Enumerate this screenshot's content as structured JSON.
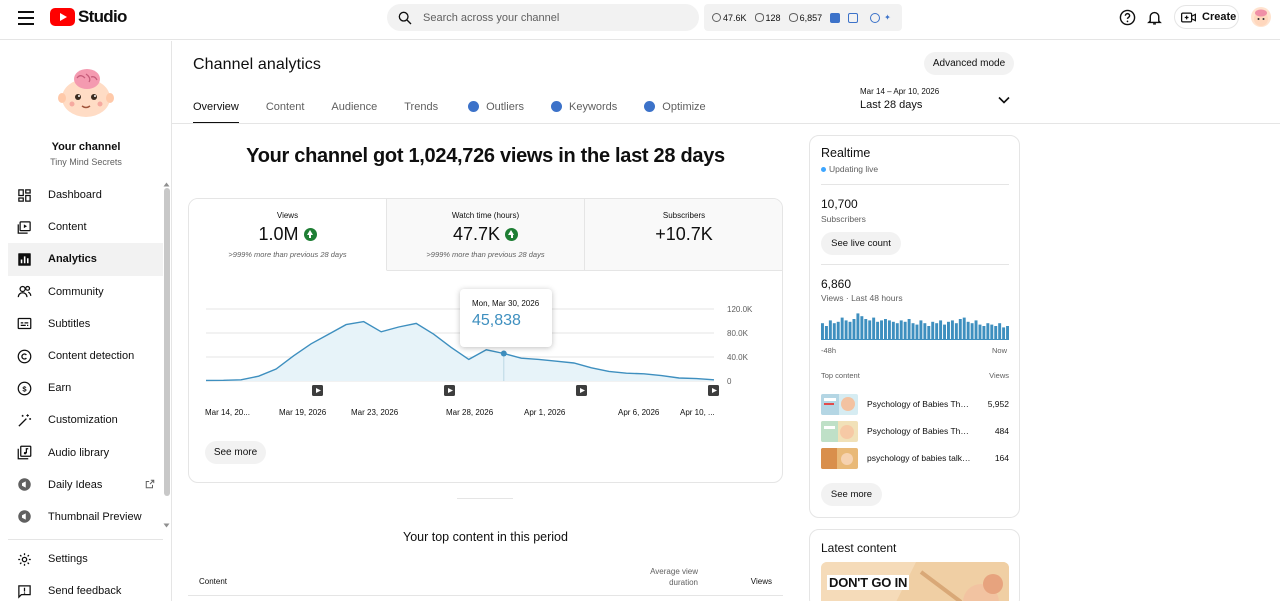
{
  "topbar": {
    "logo_text": "Studio",
    "search_placeholder": "Search across your channel",
    "stats": [
      {
        "icon": "clock-icon",
        "value": "47.6K"
      },
      {
        "icon": "eye-icon",
        "value": "128"
      },
      {
        "icon": "eye-icon",
        "value": "6,857"
      }
    ],
    "create_label": "Create"
  },
  "sidebar": {
    "channel_title": "Your channel",
    "channel_name": "Tiny Mind Secrets",
    "items": [
      {
        "label": "Dashboard",
        "icon": "dashboard-icon"
      },
      {
        "label": "Content",
        "icon": "content-icon"
      },
      {
        "label": "Analytics",
        "icon": "analytics-icon",
        "active": true
      },
      {
        "label": "Community",
        "icon": "community-icon"
      },
      {
        "label": "Subtitles",
        "icon": "subtitles-icon"
      },
      {
        "label": "Content detection",
        "icon": "copyright-icon"
      },
      {
        "label": "Earn",
        "icon": "dollar-icon"
      },
      {
        "label": "Customization",
        "icon": "magic-wand-icon"
      },
      {
        "label": "Audio library",
        "icon": "audio-library-icon"
      },
      {
        "label": "Daily Ideas",
        "icon": "extension-icon",
        "external": true
      },
      {
        "label": "Thumbnail Preview",
        "icon": "extension-icon"
      }
    ],
    "bottom_items": [
      {
        "label": "Settings",
        "icon": "gear-icon"
      },
      {
        "label": "Send feedback",
        "icon": "feedback-icon"
      }
    ]
  },
  "header": {
    "title": "Channel analytics",
    "advanced_mode": "Advanced mode",
    "tabs": [
      "Overview",
      "Content",
      "Audience",
      "Trends",
      "Outliers",
      "Keywords",
      "Optimize"
    ],
    "date_range": "Mar 14 – Apr 10, 2026",
    "date_label": "Last 28 days"
  },
  "main": {
    "headline": "Your channel got 1,024,726 views in the last 28 days",
    "metrics": [
      {
        "label": "Views",
        "value": "1.0M",
        "up": true,
        "sub": ">999% more than previous 28 days"
      },
      {
        "label": "Watch time (hours)",
        "value": "47.7K",
        "up": true,
        "sub": ">999% more than previous 28 days"
      },
      {
        "label": "Subscribers",
        "value": "+10.7K",
        "up": false,
        "sub": ""
      }
    ],
    "tooltip": {
      "date": "Mon, Mar 30, 2026",
      "value": "45,838"
    },
    "see_more": "See more",
    "top_content_title": "Your top content in this period",
    "table_headers": {
      "content": "Content",
      "avg": "Average view duration",
      "views": "Views"
    }
  },
  "chart_data": {
    "type": "area",
    "x_tick_labels": [
      "Mar 14, 20...",
      "Mar 19, 2026",
      "Mar 23, 2026",
      "Mar 28, 2026",
      "Apr 1, 2026",
      "Apr 6, 2026",
      "Apr 10, ..."
    ],
    "y_tick_labels": [
      "120.0K",
      "80.0K",
      "40.0K",
      "0"
    ],
    "ylim": [
      0,
      120000
    ],
    "values": [
      1000,
      1200,
      2000,
      8000,
      20000,
      42000,
      62000,
      78000,
      94000,
      99000,
      82000,
      90000,
      96000,
      78000,
      56000,
      36000,
      52000,
      45838,
      38000,
      36000,
      33000,
      30000,
      22000,
      16000,
      13000,
      12000,
      9000,
      5000,
      4000,
      2000
    ],
    "highlight_index": 17,
    "color": "#3e8fbf"
  },
  "realtime": {
    "title": "Realtime",
    "status": "Updating live",
    "subscribers": "10,700",
    "subscribers_label": "Subscribers",
    "see_live": "See live count",
    "views": "6,860",
    "views_label": "Views · Last 48 hours",
    "axis_left": "-48h",
    "axis_right": "Now",
    "bars": [
      12,
      10,
      14,
      12,
      13,
      16,
      14,
      13,
      15,
      19,
      17,
      15,
      14,
      16,
      13,
      14,
      15,
      14,
      13,
      12,
      14,
      13,
      15,
      12,
      11,
      14,
      12,
      10,
      13,
      12,
      14,
      11,
      13,
      14,
      12,
      15,
      16,
      13,
      12,
      14,
      11,
      10,
      12,
      11,
      10,
      12,
      9,
      10
    ],
    "top_content_label": "Top content",
    "views_col_label": "Views",
    "top_content": [
      {
        "title": "Psychology of Babies That Sh...",
        "views": "5,952"
      },
      {
        "title": "Psychology of Babies That Reveal...",
        "views": "484"
      },
      {
        "title": "psychology of babies talking to...",
        "views": "164"
      }
    ],
    "see_more": "See more"
  },
  "latest": {
    "title": "Latest content",
    "thumb_text": "DON'T GO IN"
  },
  "colors": {
    "accent": "#3e8fbf",
    "up": "#1e7e34",
    "brand": "#ff0000"
  }
}
